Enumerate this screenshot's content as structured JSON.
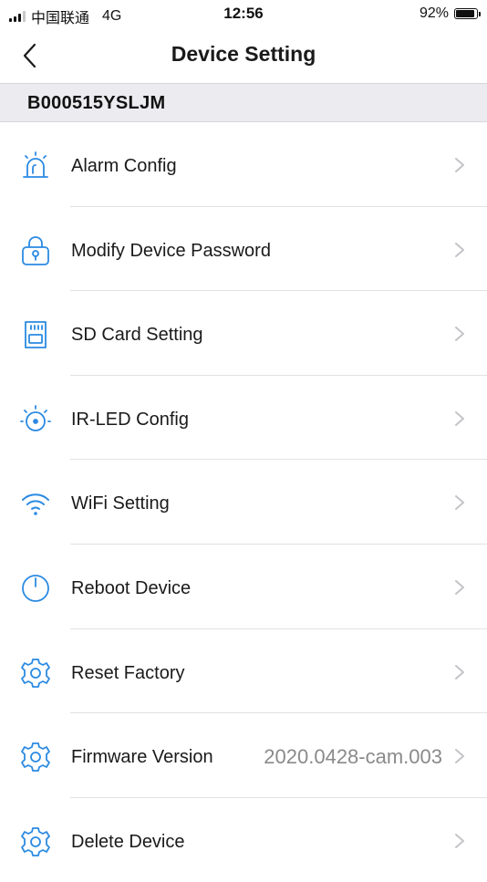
{
  "status_bar": {
    "carrier": "中国联通",
    "network": "4G",
    "time": "12:56",
    "battery_text": "92%",
    "battery_level": 0.92
  },
  "header": {
    "title": "Device Setting",
    "back_icon": "chevron-left-icon"
  },
  "device": {
    "id": "B000515YSLJM"
  },
  "settings": {
    "items": [
      {
        "label": "Alarm Config",
        "icon": "alarm-light-icon"
      },
      {
        "label": "Modify Device Password",
        "icon": "lock-icon"
      },
      {
        "label": "SD Card Setting",
        "icon": "sd-card-icon"
      },
      {
        "label": "IR-LED Config",
        "icon": "ir-led-icon"
      },
      {
        "label": "WiFi Setting",
        "icon": "wifi-icon"
      },
      {
        "label": "Reboot Device",
        "icon": "power-icon"
      },
      {
        "label": "Reset Factory",
        "icon": "gear-icon"
      },
      {
        "label": "Firmware Version",
        "value": "2020.0428-cam.003",
        "icon": "gear-icon"
      },
      {
        "label": "Delete Device",
        "icon": "gear-icon"
      }
    ]
  },
  "colors": {
    "accent": "#2b8ae2",
    "chevron": "#c4c4c8",
    "strip_bg": "#ececf0"
  }
}
